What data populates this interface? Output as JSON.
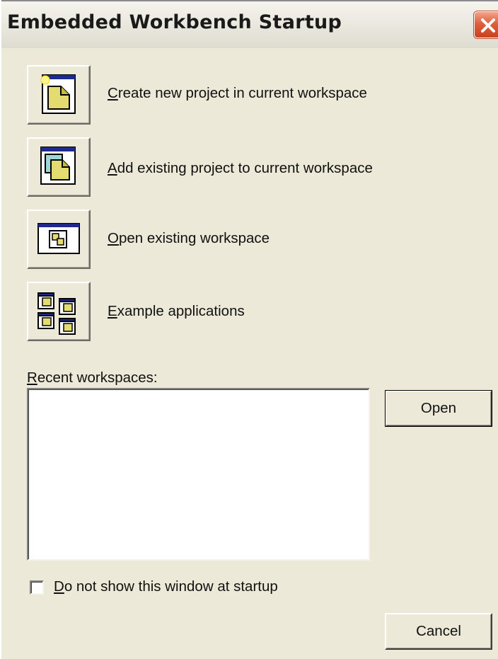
{
  "window": {
    "title": "Embedded Workbench Startup",
    "close_icon": "close-icon"
  },
  "actions": [
    {
      "mnemonic": "C",
      "rest": "reate new project in current workspace",
      "icon": "new-project-icon"
    },
    {
      "mnemonic": "A",
      "rest": "dd existing project to current workspace",
      "icon": "add-project-icon"
    },
    {
      "mnemonic": "O",
      "rest": "pen existing workspace",
      "icon": "open-workspace-icon"
    },
    {
      "mnemonic": "E",
      "rest": "xample applications",
      "icon": "example-applications-icon"
    }
  ],
  "recent": {
    "label_mnemonic": "R",
    "label_rest": "ecent workspaces:",
    "items": []
  },
  "buttons": {
    "open": "Open",
    "cancel": "Cancel"
  },
  "startup_checkbox": {
    "mnemonic": "D",
    "rest": "o not show this window at startup",
    "checked": false
  }
}
